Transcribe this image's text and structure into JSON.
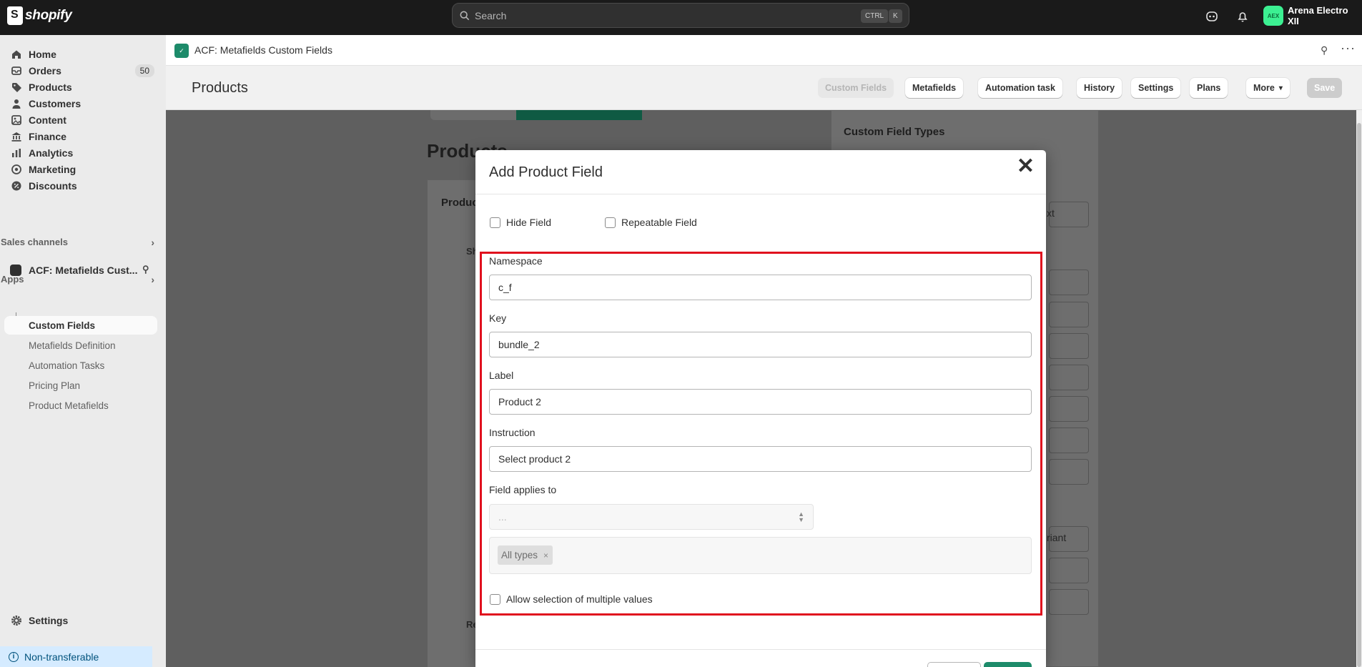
{
  "topbar": {
    "brand": "shopify",
    "search_placeholder": "Search",
    "shortcut_key1": "CTRL",
    "shortcut_key2": "K",
    "store_initials": "AEX",
    "store_name": "Arena Electro XII"
  },
  "sidebar": {
    "items": [
      {
        "label": "Home",
        "icon": "home-icon"
      },
      {
        "label": "Orders",
        "icon": "orders-icon",
        "count": "50"
      },
      {
        "label": "Products",
        "icon": "tag-icon"
      },
      {
        "label": "Customers",
        "icon": "person-icon"
      },
      {
        "label": "Content",
        "icon": "content-icon"
      },
      {
        "label": "Finance",
        "icon": "bank-icon"
      },
      {
        "label": "Analytics",
        "icon": "chart-icon"
      },
      {
        "label": "Marketing",
        "icon": "target-icon"
      },
      {
        "label": "Discounts",
        "icon": "discount-icon"
      }
    ],
    "sales_channels": "Sales channels",
    "apps": "Apps",
    "app_name": "ACF: Metafields Cust...",
    "app_sub_items": [
      "Custom Fields",
      "Metafields Definition",
      "Automation Tasks",
      "Pricing Plan",
      "Product Metafields"
    ],
    "settings": "Settings",
    "non_transferable": "Non-transferable"
  },
  "appbar": {
    "title": "ACF: Metafields Custom Fields"
  },
  "page": {
    "title": "Products",
    "buttons": [
      "Custom Fields",
      "Metafields",
      "Automation task",
      "History",
      "Settings",
      "Plans",
      "More",
      "Save"
    ]
  },
  "background": {
    "heading": "Products",
    "card_heading": "Produc",
    "side_heading": "Custom Field Types",
    "side_text_1": "xt",
    "side_text_2": "riant",
    "row_prefix": "Sh",
    "row_prefix_2": "Re"
  },
  "modal": {
    "title": "Add Product Field",
    "hide_field": "Hide Field",
    "repeatable_field": "Repeatable Field",
    "namespace_label": "Namespace",
    "namespace_value": "c_f",
    "key_label": "Key",
    "key_value": "bundle_2",
    "label_label": "Label",
    "label_value": "Product 2",
    "instruction_label": "Instruction",
    "instruction_value": "Select product 2",
    "applies_label": "Field applies to",
    "applies_select_value": "...",
    "tag": "All types",
    "tag_remove": "×",
    "allow_multiple": "Allow selection of multiple values"
  },
  "colors": {
    "accent_green": "#1d8b6a",
    "highlight_red": "#e0101e",
    "topbar_bg": "#1a1a1a"
  }
}
